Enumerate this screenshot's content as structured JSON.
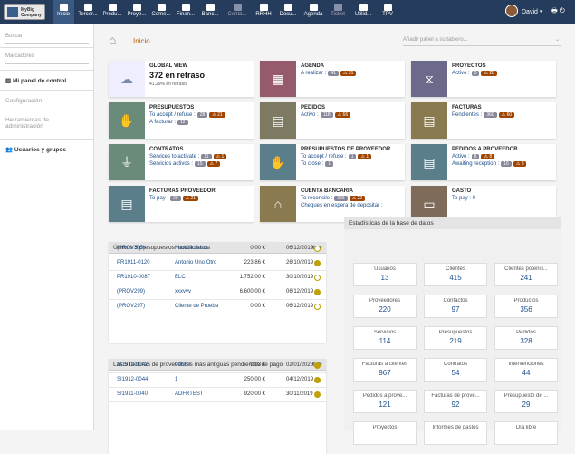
{
  "topbar": {
    "logo_text": "MyBig Company",
    "nav": [
      {
        "label": "Inicio"
      },
      {
        "label": "Tercer..."
      },
      {
        "label": "Produ..."
      },
      {
        "label": "Proye..."
      },
      {
        "label": "Come..."
      },
      {
        "label": "Finan..."
      },
      {
        "label": "Banc..."
      },
      {
        "label": "Conta..."
      },
      {
        "label": "RRHH"
      },
      {
        "label": "Docu..."
      },
      {
        "label": "Agenda"
      },
      {
        "label": "Ticket"
      },
      {
        "label": "Utilid..."
      },
      {
        "label": "TPV"
      }
    ],
    "user_name": "David",
    "user_dropdown": "▾",
    "print_icon": "🖶",
    "power_icon": "⏻"
  },
  "sidebar": {
    "search_placeholder": "Buscar",
    "bookmarks_placeholder": "Marcadores",
    "control_panel": "Mi panel de control",
    "configuration": "Configuración",
    "admin_tools": "Herramientas de administración",
    "users_groups": "Usuarios y grupos"
  },
  "main": {
    "title": "Inicio",
    "add_panel_placeholder": "Añadir panel a su tablero..."
  },
  "boxes": {
    "global": {
      "title": "GLOBAL VIEW",
      "big": "372 en retraso",
      "small": "41,29% en retraso"
    },
    "agenda": {
      "title": "AGENDA",
      "line1": "A realizar :",
      "b1": "41",
      "w1": "31"
    },
    "proyectos": {
      "title": "PROYECTOS",
      "line1": "Activo :",
      "b1": "5",
      "w1": "28"
    },
    "presupuestos": {
      "title": "PRESUPUESTOS",
      "line1": "To accept / refuse :",
      "b1": "28",
      "w1": "21",
      "line2": "A facturar :",
      "b2": "12"
    },
    "pedidos": {
      "title": "PEDIDOS",
      "line1": "Activo :",
      "b1": "118",
      "w1": "66"
    },
    "facturas": {
      "title": "FACTURAS",
      "line1": "Pendientes :",
      "b1": "360",
      "w1": "60"
    },
    "contratos": {
      "title": "CONTRATOS",
      "line1": "Services to activate :",
      "b1": "11",
      "w1": "1",
      "line2": "Servicios activos :",
      "b2": "15",
      "w2": "7"
    },
    "presup_prov": {
      "title": "PRESUPUESTOS DE PROVEEDOR",
      "line1": "To accept / refuse :",
      "b1": "1",
      "w1": "1",
      "line2": "To close :",
      "b2": "1"
    },
    "pedidos_prov": {
      "title": "PEDIDOS A PROVEEDOR",
      "line1": "Activo :",
      "b1": "8",
      "w1": "8",
      "line2": "Awaiting reception :",
      "b2": "16",
      "w2": "8"
    },
    "facturas_prov": {
      "title": "FACTURAS PROVEEDOR",
      "line1": "To pay :",
      "b1": "20",
      "w1": "21"
    },
    "cuenta": {
      "title": "CUENTA BANCARIA",
      "line1": "To reconcile :",
      "b1": "266",
      "w1": "22",
      "line2": "Cheques en espera de depositar :"
    },
    "gasto": {
      "title": "GASTO",
      "line1": "To pay : 0"
    }
  },
  "panel1": {
    "title": "Últimos 5 presupuestos modificados",
    "rows": [
      {
        "ref": "(PROV305)",
        "name": "Maritza Garcia",
        "amount": "0,00 €",
        "date": "06/12/2019",
        "status": "empty"
      },
      {
        "ref": "PR1911-0120",
        "name": "Antonio Uno Otro",
        "amount": "223,86 €",
        "date": "26/10/2019",
        "status": "fill"
      },
      {
        "ref": "PR1910-0087",
        "name": "ELC",
        "amount": "1.752,00 €",
        "date": "30/10/2019",
        "status": "empty"
      },
      {
        "ref": "(PROV299)",
        "name": "xxxvvv",
        "amount": "6.600,00 €",
        "date": "06/12/2019",
        "status": "fill"
      },
      {
        "ref": "(PROV297)",
        "name": "Cliente de Prueba",
        "amount": "0,00 €",
        "date": "06/12/2019",
        "status": "empty"
      }
    ]
  },
  "panel2": {
    "title": "Las 5 facturas de proveedores más antiguas pendientes de pago",
    "rows": [
      {
        "ref": "SI1912-0042",
        "name": "99NET",
        "amount": "0,93 €",
        "date": "02/01/2020",
        "status": "fill"
      },
      {
        "ref": "SI1912-0044",
        "name": "1",
        "amount": "250,00 €",
        "date": "04/12/2019",
        "status": "fill"
      },
      {
        "ref": "SI1911-0040",
        "name": "ADFRTEST",
        "amount": "920,00 €",
        "date": "30/11/2019",
        "status": "fill"
      }
    ]
  },
  "stats": {
    "title": "Estadísticas de la base de datos",
    "items": [
      {
        "label": "Usuarios",
        "value": "13"
      },
      {
        "label": "Clientes",
        "value": "415"
      },
      {
        "label": "Clientes potenci...",
        "value": "241"
      },
      {
        "label": "Proveedores",
        "value": "220"
      },
      {
        "label": "Contactos",
        "value": "97"
      },
      {
        "label": "Productos",
        "value": "356"
      },
      {
        "label": "Servicios",
        "value": "114"
      },
      {
        "label": "Presupuestos",
        "value": "219"
      },
      {
        "label": "Pedidos",
        "value": "328"
      },
      {
        "label": "Facturas a clientes",
        "value": "967"
      },
      {
        "label": "Contratos",
        "value": "54"
      },
      {
        "label": "Intervenciones",
        "value": "44"
      },
      {
        "label": "Pedidos a prove...",
        "value": "121"
      },
      {
        "label": "Facturas de prove...",
        "value": "92"
      },
      {
        "label": "Presupuesto de ...",
        "value": "29"
      },
      {
        "label": "Proyectos",
        "value": ""
      },
      {
        "label": "Informes de gastos",
        "value": ""
      },
      {
        "label": "Día libre",
        "value": ""
      }
    ]
  },
  "colors": {
    "topbar": "#263c5c",
    "agenda": "#955a6c",
    "proyectos": "#6c6a8a",
    "teal": "#6a8a7a",
    "gold": "#8a7a50",
    "slate": "#5a7f8a",
    "brown": "#7e6b5a"
  }
}
